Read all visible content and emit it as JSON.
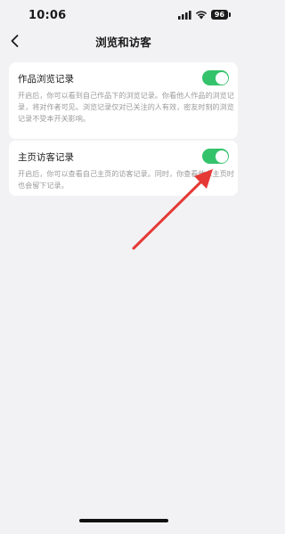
{
  "status_bar": {
    "time": "10:06",
    "battery_level": "96",
    "icons": [
      "signal-icon",
      "wifi-icon",
      "battery-icon"
    ]
  },
  "header": {
    "title": "浏览和访客",
    "back_icon": "chevron-left-icon"
  },
  "settings": [
    {
      "title": "作品浏览记录",
      "description": "开启后，你可以看到自己作品下的浏览记录。你看他人作品的浏览记录，将对作者可见。浏览记录仅对已关注的人有效，密友时刻的浏览记录不受本开关影响。",
      "enabled": true
    },
    {
      "title": "主页访客记录",
      "description": "开启后，你可以查看自己主页的访客记录。同时，你查看他人主页时也会留下记录。",
      "enabled": true
    }
  ],
  "colors": {
    "background": "#f2f2f4",
    "card": "#ffffff",
    "toggle_on": "#34c36b",
    "annotation_arrow": "#e53935",
    "secondary_text": "#9a9a9a"
  }
}
